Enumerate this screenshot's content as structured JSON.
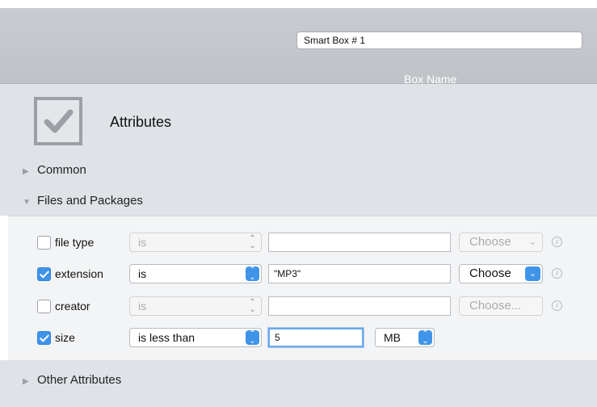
{
  "box_name": {
    "value": "Smart Box # 1",
    "label": "Box Name"
  },
  "attributes": {
    "title": "Attributes",
    "icon": "checkmark-box-icon"
  },
  "sections": {
    "common": "Common",
    "files_and_packages": "Files and Packages",
    "other_attributes": "Other Attributes"
  },
  "rules": [
    {
      "checked": false,
      "label": "file type",
      "operator": "is",
      "value": "",
      "choose": "Choose",
      "enabled": false
    },
    {
      "checked": true,
      "label": "extension",
      "operator": "is",
      "value": "\"MP3\"",
      "choose": "Choose",
      "enabled": true
    },
    {
      "checked": false,
      "label": "creator",
      "operator": "is",
      "value": "",
      "choose": "Choose...",
      "enabled": false
    },
    {
      "checked": true,
      "label": "size",
      "operator": "is less than",
      "value": "5",
      "unit": "MB",
      "enabled": true
    }
  ],
  "info_glyph": "i",
  "colors": {
    "accent": "#3f94e8",
    "panel": "#dfe3e7",
    "header": "#c5c9ce"
  }
}
